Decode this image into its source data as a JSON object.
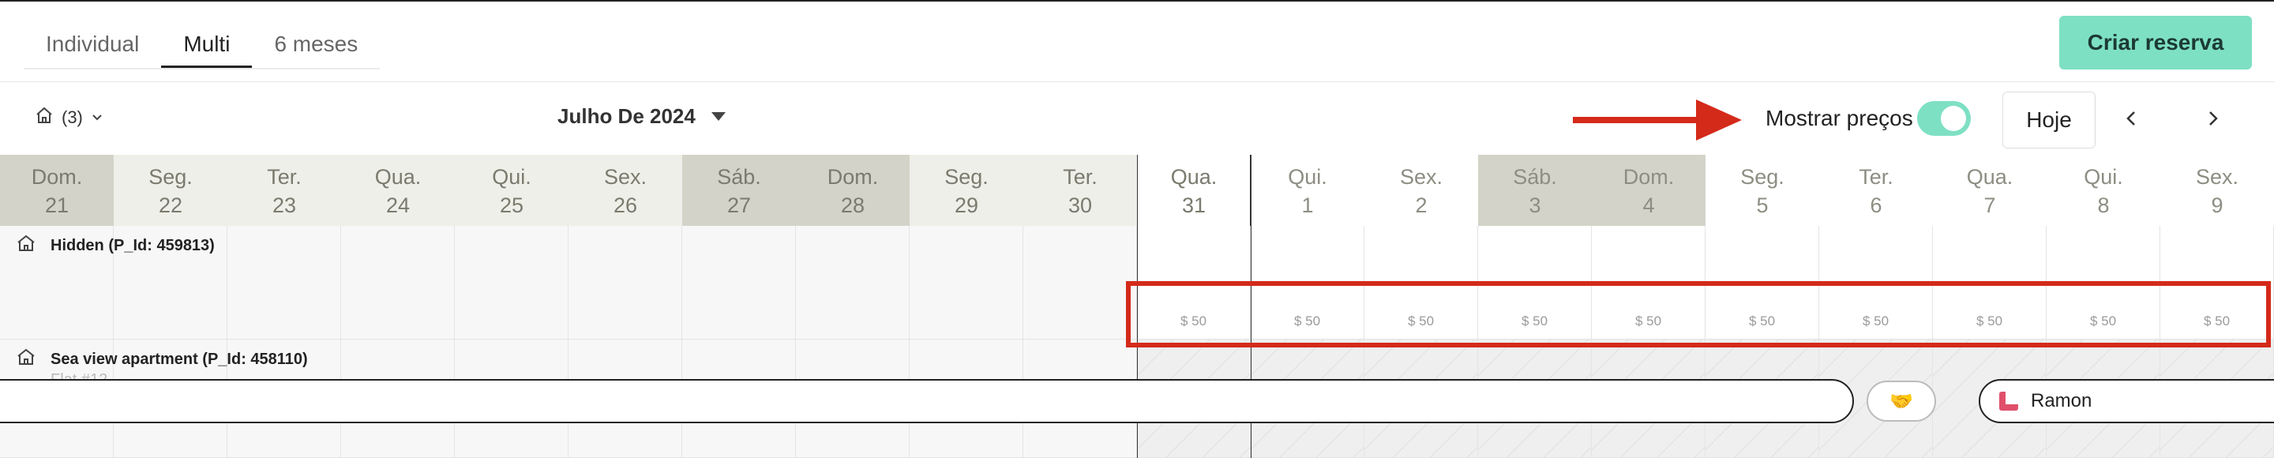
{
  "tabs": [
    {
      "label": "Individual",
      "active": false
    },
    {
      "label": "Multi",
      "active": true
    },
    {
      "label": "6 meses",
      "active": false
    }
  ],
  "create_button": "Criar reserva",
  "toolbar": {
    "property_filter_count": "(3)",
    "month_label": "Julho De 2024",
    "show_prices_label": "Mostrar preços",
    "show_prices_enabled": true,
    "today_label": "Hoje"
  },
  "days": [
    {
      "name": "Dom.",
      "num": "21",
      "type": "weekend"
    },
    {
      "name": "Seg.",
      "num": "22",
      "type": "past"
    },
    {
      "name": "Ter.",
      "num": "23",
      "type": "past"
    },
    {
      "name": "Qua.",
      "num": "24",
      "type": "past"
    },
    {
      "name": "Qui.",
      "num": "25",
      "type": "past"
    },
    {
      "name": "Sex.",
      "num": "26",
      "type": "past"
    },
    {
      "name": "Sáb.",
      "num": "27",
      "type": "weekend"
    },
    {
      "name": "Dom.",
      "num": "28",
      "type": "weekend"
    },
    {
      "name": "Seg.",
      "num": "29",
      "type": "past"
    },
    {
      "name": "Ter.",
      "num": "30",
      "type": "past"
    },
    {
      "name": "Qua.",
      "num": "31",
      "type": "today"
    },
    {
      "name": "Qui.",
      "num": "1",
      "type": "future"
    },
    {
      "name": "Sex.",
      "num": "2",
      "type": "future"
    },
    {
      "name": "Sáb.",
      "num": "3",
      "type": "weekend"
    },
    {
      "name": "Dom.",
      "num": "4",
      "type": "weekend"
    },
    {
      "name": "Seg.",
      "num": "5",
      "type": "future"
    },
    {
      "name": "Ter.",
      "num": "6",
      "type": "future"
    },
    {
      "name": "Qua.",
      "num": "7",
      "type": "future"
    },
    {
      "name": "Qui.",
      "num": "8",
      "type": "future"
    },
    {
      "name": "Sex.",
      "num": "9",
      "type": "future"
    }
  ],
  "properties": [
    {
      "name": "Hidden (P_Id: 459813)",
      "subtitle": ""
    },
    {
      "name": "Sea view apartment (P_Id: 458110)",
      "subtitle": "Flat #12"
    }
  ],
  "price_label": "$ 50",
  "booking": {
    "guest": "Ramon"
  },
  "colors": {
    "accent": "#7ee0c3",
    "highlight": "#d42a1a",
    "weekend": "#d3d3c9",
    "weekday": "#efefe9"
  }
}
